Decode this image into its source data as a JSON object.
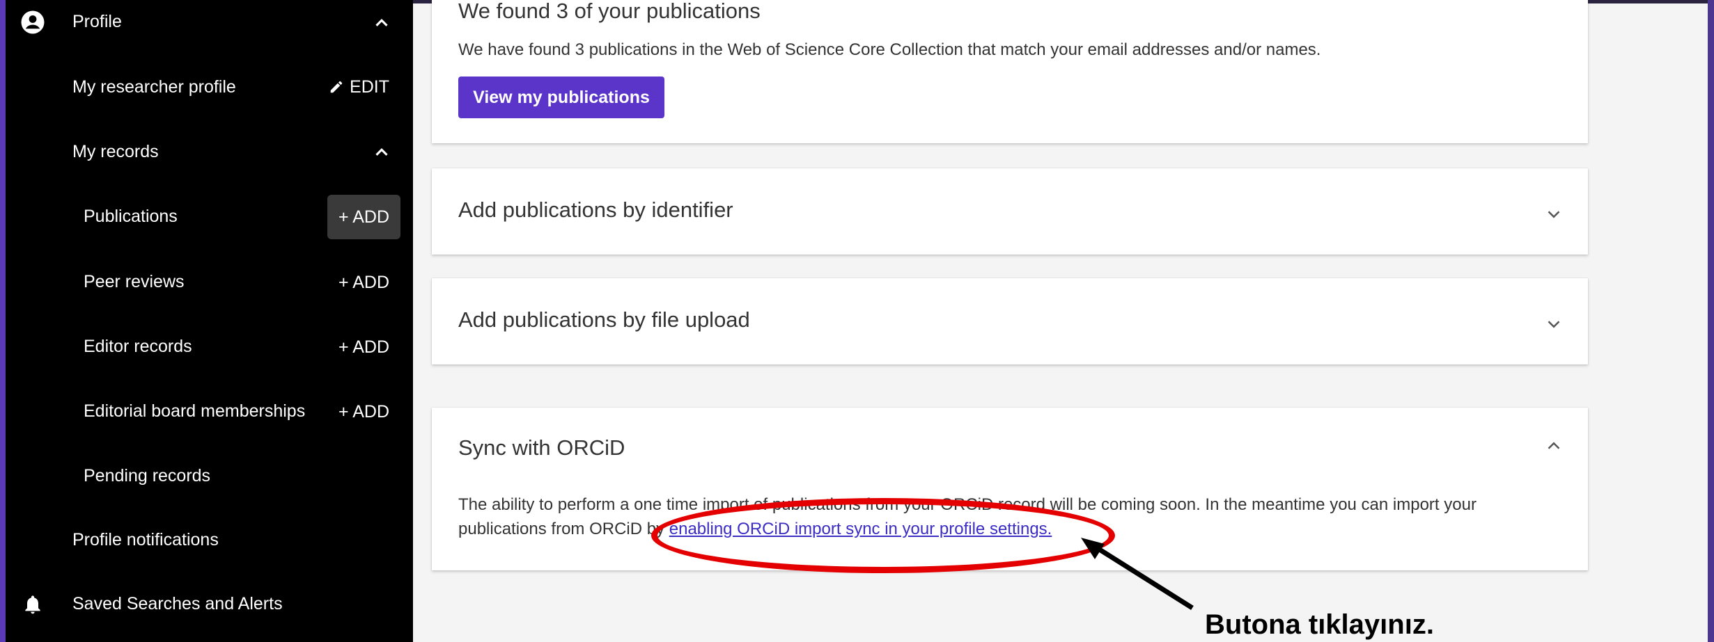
{
  "sidebar": {
    "profile_label": "Profile",
    "researcher_profile_label": "My researcher profile",
    "edit_label": "EDIT",
    "my_records_label": "My records",
    "items": [
      {
        "label": "Publications",
        "action": "+ ADD"
      },
      {
        "label": "Peer reviews",
        "action": "+ ADD"
      },
      {
        "label": "Editor records",
        "action": "+ ADD"
      },
      {
        "label": "Editorial board memberships",
        "action": "+ ADD"
      },
      {
        "label": "Pending records",
        "action": ""
      }
    ],
    "profile_notifications_label": "Profile notifications",
    "saved_searches_label": "Saved Searches and Alerts",
    "icons": [
      "account-circle-icon",
      "chevron-up-icon",
      "pencil-icon",
      "bell-icon"
    ]
  },
  "found_card": {
    "title": "We found 3 of your publications",
    "text": "We have found 3 publications in the Web of Science Core Collection that match your email addresses and/or names.",
    "button_label": "View my publications"
  },
  "identifier_card": {
    "title": "Add publications by identifier"
  },
  "upload_card": {
    "title": "Add publications by file upload"
  },
  "orcid_card": {
    "title": "Sync with ORCiD",
    "text_line1": "The ability to perform a one time import of publications from your ORCiD record will be coming soon. In the meantime you can import your",
    "text_line2_prefix": "publications from ORCiD by ",
    "link_text": "enabling ORCiD import sync in your profile settings."
  },
  "annotation": {
    "text": "Butona tıklayınız."
  },
  "colors": {
    "accent": "#5b35c9",
    "sidebar_bg": "#000000",
    "annotation_red": "#e40000"
  }
}
